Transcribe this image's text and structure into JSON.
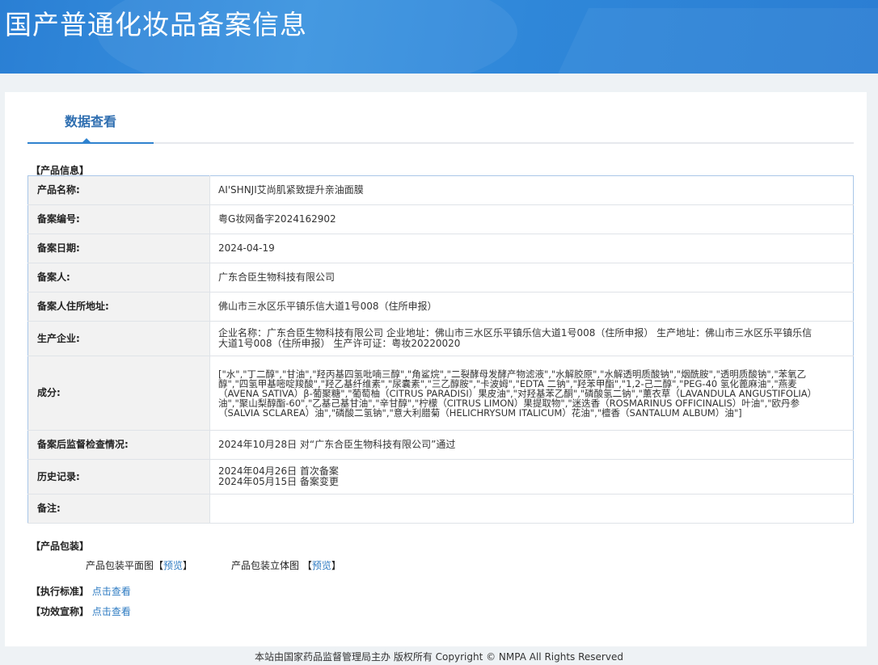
{
  "banner": {
    "title": "国产普通化妆品备案信息"
  },
  "tabs": {
    "active_label": "数据查看"
  },
  "product_info": {
    "section_title": "【产品信息】",
    "rows": [
      {
        "key": "产品名称:",
        "value": "AI'SHNJI艾尚肌紧致提升亲油面膜"
      },
      {
        "key": "备案编号:",
        "value": "粤G妆网备字2024162902"
      },
      {
        "key": "备案日期:",
        "value": "2024-04-19"
      },
      {
        "key": "备案人:",
        "value": "广东合臣生物科技有限公司"
      },
      {
        "key": "备案人住所地址:",
        "value": "佛山市三水区乐平镇乐信大道1号008（住所申报）"
      },
      {
        "key": "生产企业:",
        "value": "企业名称：广东合臣生物科技有限公司 企业地址：佛山市三水区乐平镇乐信大道1号008（住所申报） 生产地址：佛山市三水区乐平镇乐信大道1号008（住所申报） 生产许可证：粤妆20220020"
      },
      {
        "key": "成分:",
        "value": "[\"水\",\"丁二醇\",\"甘油\",\"羟丙基四氢吡喃三醇\",\"角鲨烷\",\"二裂酵母发酵产物滤液\",\"水解胶原\",\"水解透明质酸钠\",\"烟酰胺\",\"透明质酸钠\",\"苯氧乙醇\",\"四氢甲基嘧啶羧酸\",\"羟乙基纤维素\",\"尿囊素\",\"三乙醇胺\",\"卡波姆\",\"EDTA 二钠\",\"羟苯甲酯\",\"1,2-己二醇\",\"PEG-40 氢化蓖麻油\",\"燕麦（AVENA SATIVA）β-葡聚糖\",\"葡萄柚（CITRUS PARADISI）果皮油\",\"对羟基苯乙酮\",\"磷酸氢二钠\",\"薰衣草（LAVANDULA ANGUSTIFOLIA）油\",\"聚山梨醇酯-60\",\"乙基己基甘油\",\"辛甘醇\",\"柠檬（CITRUS LIMON）果提取物\",\"迷迭香（ROSMARINUS OFFICINALIS）叶油\",\"欧丹参（SALVIA SCLAREA）油\",\"磷酸二氢钠\",\"意大利腊菊（HELICHRYSUM ITALICUM）花油\",\"檀香（SANTALUM ALBUM）油\"]"
      },
      {
        "key": "备案后监督检查情况:",
        "value": "2024年10月28日 对“广东合臣生物科技有限公司”通过"
      },
      {
        "key": "历史记录:",
        "value": "2024年04月26日 首次备案",
        "value2": "2024年05月15日 备案变更"
      },
      {
        "key": "备注:",
        "value": ""
      }
    ]
  },
  "packaging": {
    "section_title": "【产品包装】",
    "flat_label": "产品包装平面图",
    "flat_link": "预览",
    "solid_label": "产品包装立体图",
    "solid_link": "预览",
    "bracket_open": "【",
    "bracket_close": "】"
  },
  "standard": {
    "label": "【执行标准】",
    "link": "点击查看"
  },
  "claims": {
    "label": "【功效宣称】",
    "link": "点击查看"
  },
  "footer": {
    "text": "本站由国家药品监督管理局主办 版权所有 Copyright © NMPA All Rights Reserved"
  }
}
